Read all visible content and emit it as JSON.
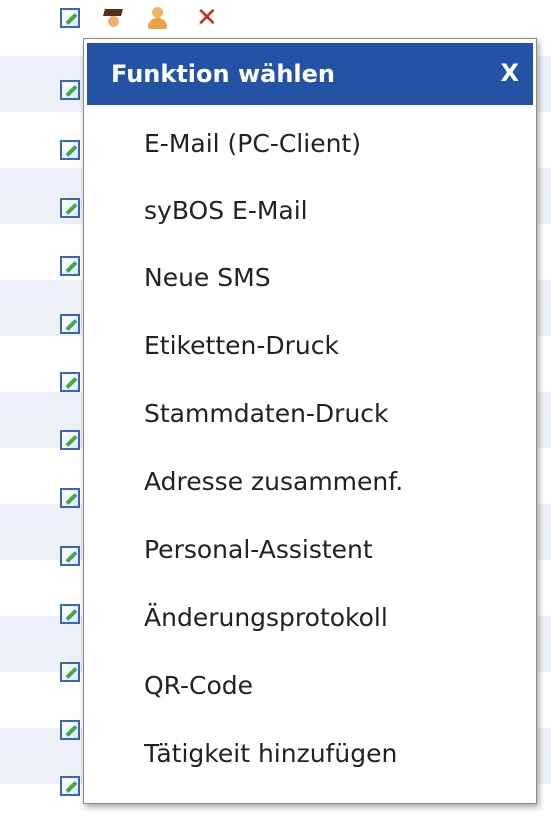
{
  "menu": {
    "title": "Funktion wählen",
    "close_label": "X",
    "items": [
      "E-Mail (PC-Client)",
      "syBOS E-Mail",
      "Neue SMS",
      "Etiketten-Druck",
      "Stammdaten-Druck",
      "Adresse zusammenf.",
      "Personal-Assistent",
      "Änderungsprotokoll",
      "QR-Code",
      "Tätigkeit hinzufügen"
    ]
  },
  "icons": {
    "top_row": [
      "edit-icon",
      "graduation-cap-icon",
      "user-icon",
      "delete-icon"
    ],
    "row_icon": "edit-icon"
  },
  "colors": {
    "header_bg": "#2453a6",
    "header_text": "#ffffff",
    "row_alt": "#eef0f7"
  }
}
